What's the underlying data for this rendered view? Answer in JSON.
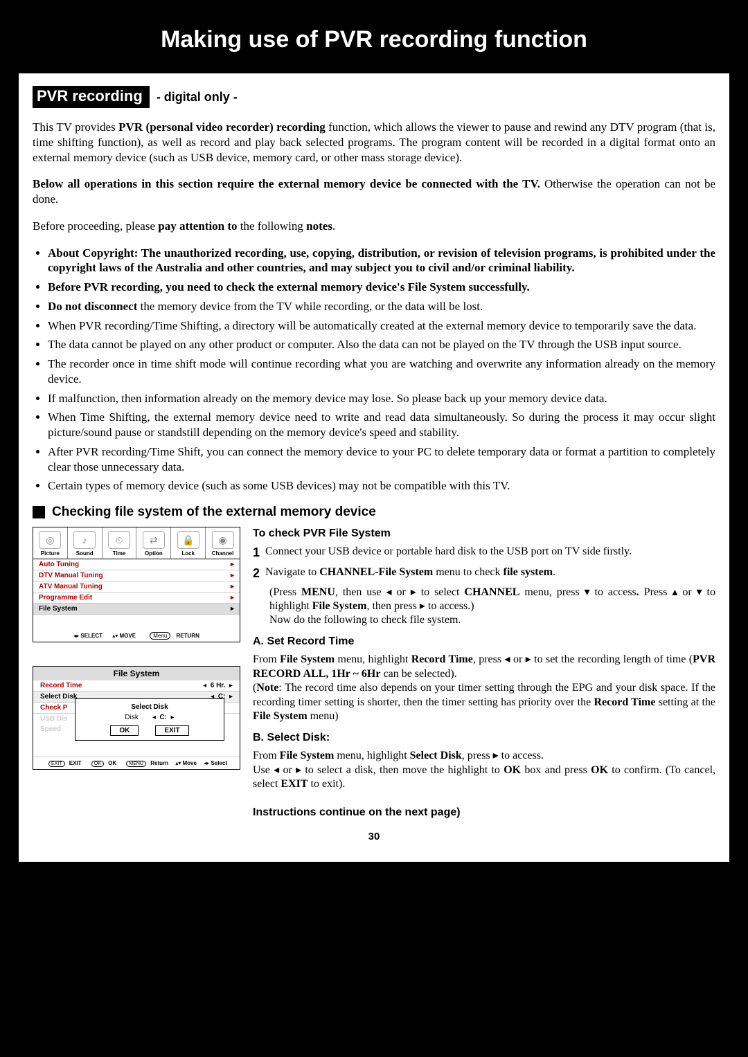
{
  "title": "Making use of PVR recording function",
  "heading_black": "PVR recording",
  "heading_sub": "- digital only -",
  "intro1_a": "This TV provides ",
  "intro1_b": "PVR (personal video recorder) recording",
  "intro1_c": " function, which allows the viewer to pause and rewind any DTV program (that is, time shifting function), as well as record and play back selected programs. The program content will be recorded in a digital format onto an external memory device (such as USB device, memory card, or other mass storage device).",
  "intro2_a": "Below all operations in this section require the external memory device be connected with the TV.",
  "intro2_b": " Otherwise the operation can not be done.",
  "intro3_a": "Before proceeding, please ",
  "intro3_b": "pay attention to",
  "intro3_c": " the following ",
  "intro3_d": "notes",
  "intro3_e": ".",
  "bullet1": "About Copyright: The unauthorized recording, use, copying, distribution, or revision of television programs, is prohibited under the copyright laws of the Australia and other countries, and may subject you to civil and/or criminal liability.",
  "bullet2": "Before PVR recording, you need to check the external memory device's File System successfully.",
  "bullet3_a": "Do not disconnect",
  "bullet3_b": " the memory device from the TV while recording, or the data will be lost.",
  "bullet4": "When PVR recording/Time Shifting, a directory will be automatically created at the external memory device to temporarily save the data.",
  "bullet5": "The data cannot be played on any other product or computer. Also the data can not be played on the TV through the USB input source.",
  "bullet6": "The recorder once in time shift mode will continue recording what you are watching and overwrite any information already on the memory device.",
  "bullet7": "If malfunction, then information already on the memory device may lose. So please back up your memory device data.",
  "bullet8": "When Time Shifting, the external memory device need to write and read data simultaneously. So during the process it may occur slight picture/sound pause or standstill depending on the memory device's speed and stability.",
  "bullet9": "After PVR recording/Time Shift, you can connect the memory device to your PC to delete temporary data or format a partition to completely clear those unnecessary data.",
  "bullet10": "Certain types of memory device (such as some USB devices) may not be compatible with this TV.",
  "sub_heading": "Checking file system of the external memory device",
  "menu1": {
    "tabs": [
      "Picture",
      "Sound",
      "Time",
      "Option",
      "Lock",
      "Channel"
    ],
    "items": [
      "Auto Tuning",
      "DTV Manual Tuning",
      "ATV Manual Tuning",
      "Programme Edit",
      "File System"
    ],
    "foot": {
      "select": "SELECT",
      "move": "MOVE",
      "return": "RETURN",
      "menu": "Menu"
    }
  },
  "menu2": {
    "title": "File System",
    "rows": [
      {
        "label": "Record Time",
        "value": "6 Hr."
      },
      {
        "label": "Select Disk",
        "value": "C:"
      },
      {
        "label": "Check P"
      }
    ],
    "faded": [
      "USB Dis",
      "Speed"
    ],
    "popup": {
      "title": "Select Disk",
      "disk": "Disk",
      "val": "C:",
      "ok": "OK",
      "exit": "EXIT"
    },
    "foot": {
      "exit": "EXIT",
      "ok": "OK",
      "return": "Return",
      "move": "Move",
      "select": "Select",
      "exitbtn": "EXIT",
      "okbtn": "OK",
      "menubtn": "MENU"
    }
  },
  "right": {
    "h1": "To check PVR File System",
    "step1_num": "1",
    "step1": "Connect your USB device or portable hard disk to the USB port on TV side firstly.",
    "step2_num": "2",
    "step2_a": "Navigate to ",
    "step2_b": "CHANNEL-File System",
    "step2_c": " menu to check ",
    "step2_d": "file system",
    "step2_e": ".",
    "step2_f1": "(Press ",
    "step2_f2": "MENU",
    "step2_f3": ", then use ◂ or ▸ to select ",
    "step2_f4": "CHANNEL",
    "step2_f5": " menu, press ▾ to access",
    "step2_f6": ". ",
    "step2_f7": "Press ▴ or ▾ to highlight ",
    "step2_f8": "File System",
    "step2_f9": ", then press ▸ to access.)",
    "step2_g": "Now do the following to check file system.",
    "a_title": "A. Set Record Time",
    "a_1": "From ",
    "a_2": "File System",
    "a_3": " menu, highlight ",
    "a_4": "Record Time",
    "a_5": ", press ◂ or ▸ to set the recording length of time (",
    "a_6": "PVR RECORD ALL, 1Hr ~ 6Hr",
    "a_7": " can be selected).",
    "a_8": "(",
    "a_9": "Note",
    "a_10": ": The record time also depends on your timer setting through the EPG and your disk space. If the recording timer setting is shorter, then the timer setting has priority over the ",
    "a_11": "Record Time",
    "a_12": " setting at the ",
    "a_13": "File System",
    "a_14": " menu)",
    "b_title": "B. Select Disk:",
    "b_1": "From ",
    "b_2": "File System",
    "b_3": " menu, highlight ",
    "b_4": "Select Disk",
    "b_5": ", press ▸ to access.",
    "b_6": "Use ◂ or ▸ to select a disk, then move the highlight to ",
    "b_7": "OK",
    "b_8": " box and press ",
    "b_9": "OK",
    "b_10": " to confirm. (To cancel, select ",
    "b_11": "EXIT",
    "b_12": " to exit).",
    "cont": "Instructions continue on the next page)"
  },
  "pagenum": "30"
}
